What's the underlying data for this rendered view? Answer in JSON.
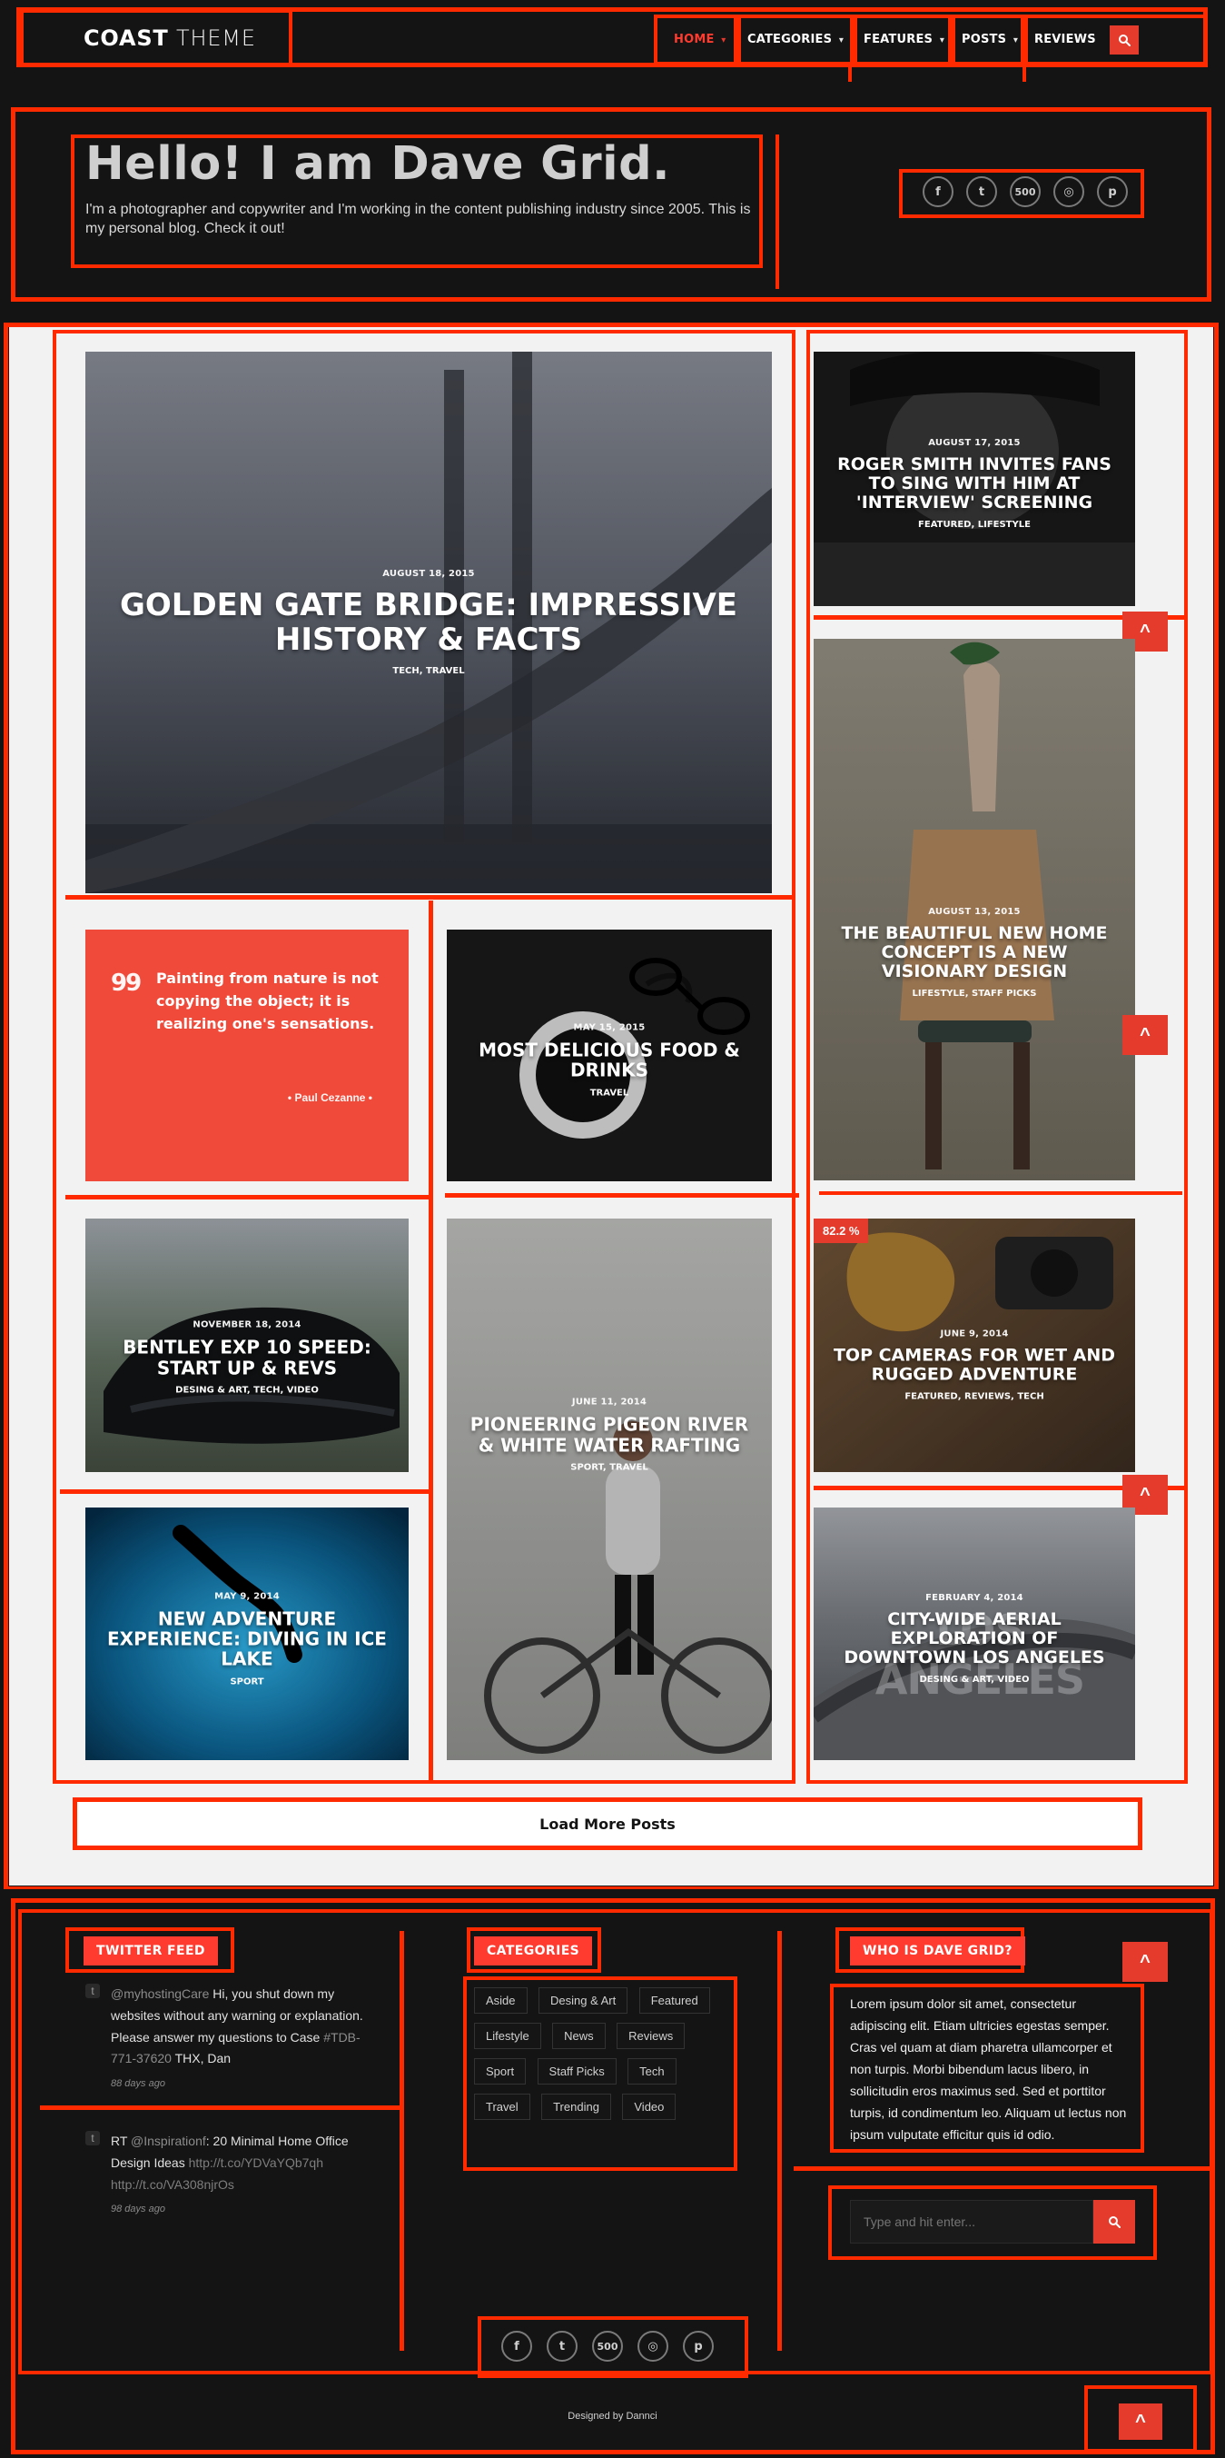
{
  "colors": {
    "background": "#141414",
    "accent_red": "#e53b2c",
    "brand_red": "#ff3b30",
    "outline_red": "#ff2a00",
    "content_bg": "#f2f2f2"
  },
  "header": {
    "logo": {
      "strong": "COAST",
      "light": " THEME"
    },
    "nav": [
      {
        "label": "HOME",
        "has_dropdown": true,
        "active": true
      },
      {
        "label": "CATEGORIES",
        "has_dropdown": true,
        "active": false
      },
      {
        "label": "FEATURES",
        "has_dropdown": true,
        "active": false
      },
      {
        "label": "POSTS",
        "has_dropdown": true,
        "active": false
      },
      {
        "label": "REVIEWS",
        "has_dropdown": false,
        "active": false
      }
    ],
    "search_icon": "search-icon"
  },
  "intro": {
    "title": "Hello! I am Dave Grid.",
    "subtitle": "I'm a photographer and copywriter and I'm working in the content publishing industry since 2005. This is my personal blog. Check it out!",
    "social": [
      {
        "name": "facebook",
        "glyph": "f"
      },
      {
        "name": "twitter",
        "glyph": "t"
      },
      {
        "name": "500px",
        "glyph": "500"
      },
      {
        "name": "instagram",
        "glyph": "◎"
      },
      {
        "name": "pinterest",
        "glyph": "p"
      }
    ]
  },
  "posts": {
    "featured_large": {
      "date": "AUGUST 18, 2015",
      "title": "GOLDEN GATE BRIDGE: IMPRESSIVE HISTORY & FACTS",
      "tags": "TECH, TRAVEL"
    },
    "quote": {
      "mark": "99",
      "text": "Painting from nature is not copying the object; it is realizing one's sensations.",
      "author": "• Paul Cezanne •"
    },
    "food": {
      "date": "MAY 15, 2015",
      "title": "MOST DELICIOUS FOOD & DRINKS",
      "tags": "TRAVEL"
    },
    "bentley": {
      "date": "NOVEMBER 18, 2014",
      "title": "BENTLEY EXP 10 SPEED: START UP & REVS",
      "tags": "DESING & ART, TECH, VIDEO"
    },
    "rafting": {
      "date": "JUNE 11, 2014",
      "title": "PIONEERING PIGEON RIVER & WHITE WATER RAFTING",
      "tags": "SPORT, TRAVEL"
    },
    "ice_lake": {
      "date": "MAY 9, 2014",
      "title": "NEW ADVENTURE EXPERIENCE: DIVING IN ICE LAKE",
      "tags": "SPORT"
    },
    "roger": {
      "date": "AUGUST 17, 2015",
      "title": "ROGER SMITH INVITES FANS TO SING WITH HIM AT 'INTERVIEW' SCREENING",
      "tags": "FEATURED, LIFESTYLE"
    },
    "home_concept": {
      "date": "AUGUST 13, 2015",
      "title": "THE BEAUTIFUL NEW HOME CONCEPT IS A NEW VISIONARY DESIGN",
      "tags": "LIFESTYLE, STAFF PICKS"
    },
    "cameras": {
      "badge": "82.2 %",
      "date": "JUNE 9, 2014",
      "title": "TOP CAMERAS FOR WET AND RUGGED ADVENTURE",
      "tags": "FEATURED, REVIEWS, TECH"
    },
    "los_angeles": {
      "bg_word": "LOS ANGELES",
      "date": "FEBRUARY 4, 2014",
      "title": "CITY-WIDE AERIAL EXPLORATION OF DOWNTOWN LOS ANGELES",
      "tags": "DESING & ART, VIDEO"
    }
  },
  "load_more": {
    "label": "Load More Posts"
  },
  "footer": {
    "twitter_feed": {
      "heading": "TWITTER FEED",
      "tweets": [
        {
          "handle": "@myhostingCare",
          "text1": " Hi, you shut down my websites without any warning or explanation. Please answer my questions to Case ",
          "case": "#TDB-771-37620",
          "text2": " THX, Dan",
          "time": "88 days ago"
        },
        {
          "prefix": "RT ",
          "handle": "@Inspirationf",
          "text": ": 20 Minimal Home Office Design Ideas ",
          "link1": "http://t.co/YDVaYQb7qh",
          "link2": "http://t.co/VA308njrOs",
          "time": "98 days ago"
        }
      ]
    },
    "categories": {
      "heading": "CATEGORIES",
      "items": [
        "Aside",
        "Desing & Art",
        "Featured",
        "Lifestyle",
        "News",
        "Reviews",
        "Sport",
        "Staff Picks",
        "Tech",
        "Travel",
        "Trending",
        "Video"
      ]
    },
    "about": {
      "heading": "WHO IS DAVE GRID?",
      "text": "Lorem ipsum dolor sit amet, consectetur adipiscing elit. Etiam ultricies egestas semper. Cras vel quam at diam pharetra ullamcorper et non turpis. Morbi bibendum lacus libero, in sollicitudin eros maximus sed. Sed et porttitor turpis, id condimentum leo. Aliquam ut lectus non ipsum vulputate efficitur quis id odio."
    },
    "search": {
      "placeholder": "Type and hit enter...",
      "icon": "search-icon"
    },
    "social": [
      {
        "name": "facebook",
        "glyph": "f"
      },
      {
        "name": "twitter",
        "glyph": "t"
      },
      {
        "name": "500px",
        "glyph": "500"
      },
      {
        "name": "instagram",
        "glyph": "◎"
      },
      {
        "name": "pinterest",
        "glyph": "p"
      }
    ],
    "credit": "Designed by Dannci"
  },
  "ui": {
    "up_arrow": "^"
  }
}
